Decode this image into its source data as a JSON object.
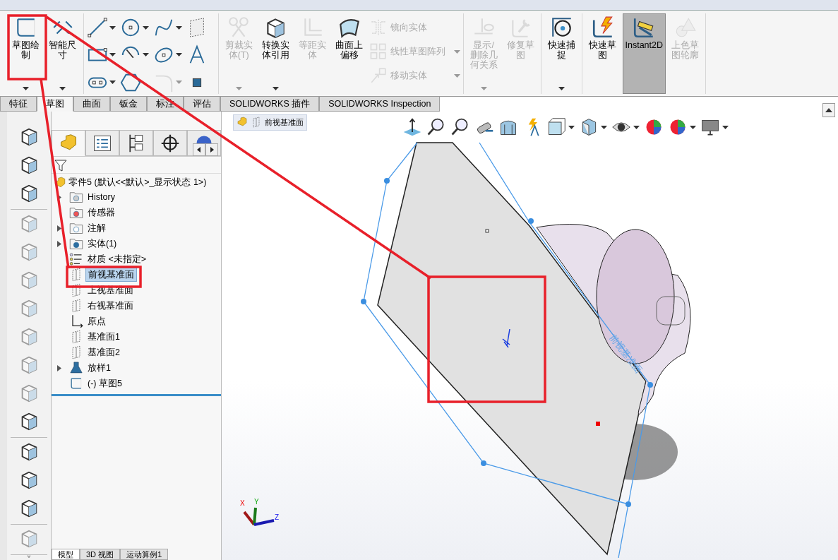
{
  "ribbon_groups": [
    {
      "items": [
        {
          "kind": "large",
          "label": "草图绘制",
          "disabled": false,
          "dropdown": true,
          "pressed": false
        },
        {
          "kind": "large",
          "label": "智能尺寸",
          "disabled": false,
          "dropdown": true,
          "pressed": false
        }
      ]
    },
    {
      "items": [
        {
          "kind": "tool_grid",
          "tools": [
            {
              "dropdown": true,
              "disabled": false
            },
            {
              "dropdown": true,
              "disabled": false
            },
            {
              "dropdown": true,
              "disabled": false
            },
            {
              "dropdown": false,
              "disabled": false
            },
            {
              "dropdown": true,
              "disabled": false
            },
            {
              "dropdown": true,
              "disabled": false
            },
            {
              "dropdown": true,
              "disabled": false
            },
            {
              "dropdown": false,
              "disabled": false
            },
            {
              "dropdown": true,
              "disabled": false
            },
            {
              "dropdown": false,
              "disabled": false
            },
            {
              "dropdown": true,
              "disabled": true
            },
            {
              "dropdown": false,
              "disabled": false
            }
          ]
        }
      ]
    },
    {
      "items": [
        {
          "kind": "large",
          "label": "剪裁实体(T)",
          "disabled": true,
          "dropdown": true,
          "pressed": false
        },
        {
          "kind": "large",
          "label": "转换实体引用",
          "disabled": false,
          "dropdown": true,
          "pressed": false
        },
        {
          "kind": "large",
          "label": "等距实体",
          "disabled": true,
          "dropdown": false,
          "pressed": false
        },
        {
          "kind": "large",
          "label": "曲面上偏移",
          "disabled": false,
          "dropdown": false,
          "pressed": false
        },
        {
          "kind": "stack",
          "rows": [
            {
              "label": "镜向实体",
              "disabled": true,
              "dropdown": false
            },
            {
              "label": "线性草图阵列",
              "disabled": true,
              "dropdown": true
            },
            {
              "label": "移动实体",
              "disabled": true,
              "dropdown": true
            }
          ]
        }
      ]
    },
    {
      "items": [
        {
          "kind": "large",
          "label": "显示/删除几何关系",
          "disabled": true,
          "dropdown": true,
          "pressed": false
        },
        {
          "kind": "large",
          "label": "修复草图",
          "disabled": true,
          "dropdown": false,
          "pressed": false
        }
      ]
    },
    {
      "items": [
        {
          "kind": "large",
          "label": "快速捕捉",
          "disabled": false,
          "dropdown": true,
          "pressed": false
        }
      ]
    },
    {
      "items": [
        {
          "kind": "large",
          "label": "快速草图",
          "disabled": false,
          "dropdown": false,
          "pressed": false
        },
        {
          "kind": "large",
          "label": "Instant2D",
          "disabled": false,
          "dropdown": false,
          "pressed": true
        },
        {
          "kind": "large",
          "label": "上色草图轮廓",
          "disabled": true,
          "dropdown": false,
          "pressed": false
        }
      ]
    }
  ],
  "tabs": [
    {
      "label": "特征",
      "selected": false
    },
    {
      "label": "草图",
      "selected": true
    },
    {
      "label": "曲面",
      "selected": false
    },
    {
      "label": "钣金",
      "selected": false
    },
    {
      "label": "标注",
      "selected": false
    },
    {
      "label": "评估",
      "selected": false
    },
    {
      "label": "SOLIDWORKS 插件",
      "selected": false
    },
    {
      "label": "SOLIDWORKS Inspection",
      "selected": false
    }
  ],
  "left_toolbar": [
    [
      {
        "disabled": false
      },
      {
        "disabled": false
      },
      {
        "disabled": false
      }
    ],
    [
      {
        "disabled": true
      },
      {
        "disabled": true
      },
      {
        "disabled": true
      },
      {
        "disabled": true
      },
      {
        "disabled": true
      },
      {
        "disabled": true
      },
      {
        "disabled": true
      },
      {
        "disabled": false
      }
    ],
    [
      {
        "disabled": false
      },
      {
        "disabled": false
      },
      {
        "disabled": false
      }
    ],
    [
      {
        "disabled": true
      }
    ]
  ],
  "panel_tabs": [
    {
      "selected": true
    },
    {
      "selected": false
    },
    {
      "selected": false
    },
    {
      "selected": false
    },
    {
      "selected": false
    }
  ],
  "tree": {
    "label": "零件5 (默认<<默认>_显示状态 1>)",
    "kind": "part",
    "children": [
      {
        "label": "History",
        "kind": "history",
        "collapsed": true,
        "selected": false
      },
      {
        "label": "传感器",
        "kind": "sensor",
        "collapsed": false,
        "selected": false
      },
      {
        "label": "注解",
        "kind": "annotation",
        "collapsed": true,
        "selected": false
      },
      {
        "label": "实体(1)",
        "kind": "solid",
        "collapsed": true,
        "selected": false
      },
      {
        "label": "材质 <未指定>",
        "kind": "material",
        "collapsed": false,
        "selected": false
      },
      {
        "label": "前视基准面",
        "kind": "plane",
        "collapsed": false,
        "selected": true
      },
      {
        "label": "上视基准面",
        "kind": "plane",
        "collapsed": false,
        "selected": false
      },
      {
        "label": "右视基准面",
        "kind": "plane",
        "collapsed": false,
        "selected": false
      },
      {
        "label": "原点",
        "kind": "origin",
        "collapsed": false,
        "selected": false
      },
      {
        "label": "基准面1",
        "kind": "plane",
        "collapsed": false,
        "selected": false
      },
      {
        "label": "基准面2",
        "kind": "plane",
        "collapsed": false,
        "selected": false
      },
      {
        "label": "放样1",
        "kind": "loft",
        "collapsed": true,
        "selected": false
      },
      {
        "label": "(-) 草图5",
        "kind": "sketch",
        "collapsed": false,
        "selected": false
      }
    ]
  },
  "bottom_tabs": [
    {
      "label": "模型",
      "selected": true
    },
    {
      "label": "3D 视图",
      "selected": false
    },
    {
      "label": "运动算例1",
      "selected": false
    }
  ],
  "breadcrumb": {
    "label": "前视基准面"
  },
  "view_toolbar": [
    {
      "dropdown": false
    },
    {
      "dropdown": false
    },
    {
      "dropdown": false
    },
    {
      "dropdown": false
    },
    {
      "dropdown": false
    },
    {
      "dropdown": false
    },
    {
      "dropdown": true
    },
    {
      "dropdown": true
    },
    {
      "dropdown": true
    },
    {
      "dropdown": false
    },
    {
      "dropdown": true
    },
    {
      "dropdown": true
    }
  ],
  "plane_label": "前视基准面",
  "triad": {
    "x": "X",
    "y": "Y",
    "z": "Z"
  }
}
